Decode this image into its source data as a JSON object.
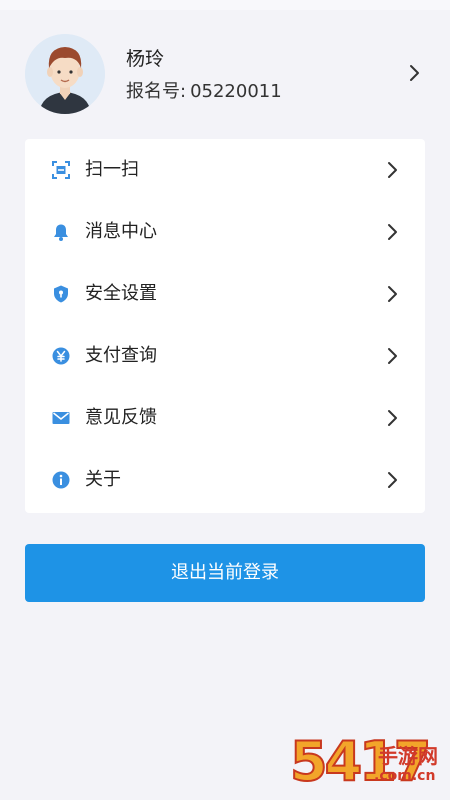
{
  "profile": {
    "name": "杨玲",
    "reg_label": "报名号:",
    "reg_value": "05220011"
  },
  "menu": {
    "items": [
      {
        "label": "扫一扫",
        "icon": "scan-icon"
      },
      {
        "label": "消息中心",
        "icon": "bell-icon"
      },
      {
        "label": "安全设置",
        "icon": "shield-icon"
      },
      {
        "label": "支付查询",
        "icon": "yen-icon"
      },
      {
        "label": "意见反馈",
        "icon": "mail-icon"
      },
      {
        "label": "关于",
        "icon": "info-icon"
      }
    ]
  },
  "logout": {
    "label": "退出当前登录"
  },
  "watermark": {
    "number": "5417",
    "text": "手游网",
    "domain": ".com.cn"
  },
  "colors": {
    "accent": "#1e93e6",
    "icon": "#3a8fe0",
    "background": "#f3f3f8"
  }
}
